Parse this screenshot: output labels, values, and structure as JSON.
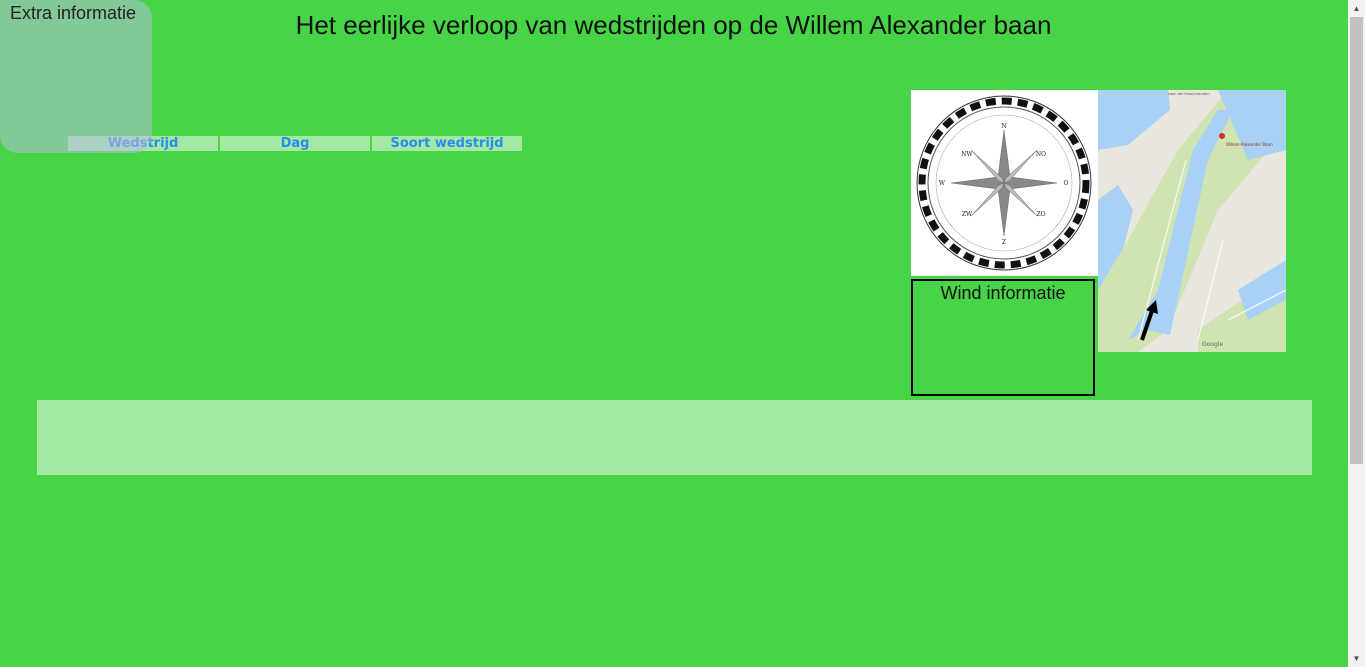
{
  "page": {
    "title": "Het eerlijke verloop van wedstrijden op de Willem Alexander baan"
  },
  "extra_panel": {
    "label": "Extra informatie"
  },
  "tabs": [
    {
      "label": "Wedstrijd"
    },
    {
      "label": "Dag"
    },
    {
      "label": "Soort wedstrijd"
    }
  ],
  "compass": {
    "icon": "compass-rose-icon",
    "labels": {
      "n": "N",
      "no": "NO",
      "o": "O",
      "zo": "ZO",
      "z": "Z",
      "zw": "ZW",
      "w": "W",
      "nw": "NW"
    }
  },
  "map": {
    "icon": "map-image",
    "place_label": "Willem-Alexander Baan",
    "top_label": "Laan der Kroonvrouwen",
    "google_mark": "Google"
  },
  "wind": {
    "label": "Wind informatie"
  },
  "colors": {
    "background": "#47d447",
    "tab_bg": "#a3e8a3",
    "tab_text": "#2a8cf0",
    "strip_bg": "#a3e8a3"
  },
  "scrollbar": {
    "up_icon": "▲",
    "down_icon": "▼"
  }
}
